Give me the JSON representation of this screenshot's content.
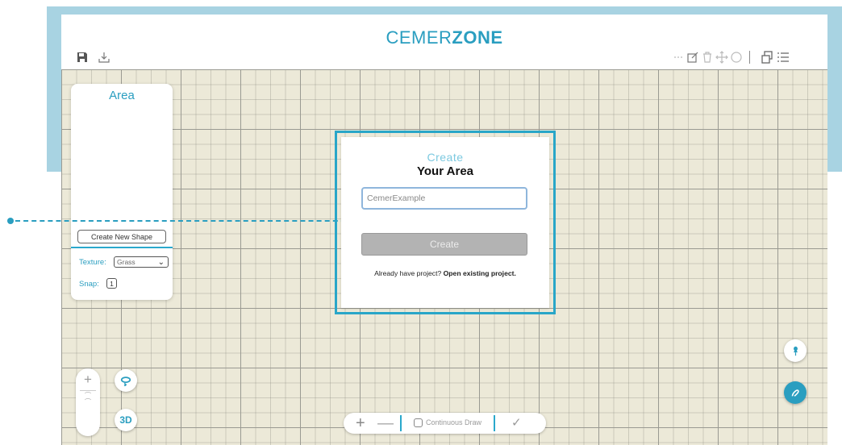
{
  "header": {
    "brand_regular": "CEMER",
    "brand_bold": "ZONE"
  },
  "toolbar": {
    "left_icons": [
      "save-icon",
      "download-icon"
    ],
    "right_icons": [
      "select-icon",
      "edit-icon",
      "trash-icon",
      "move-icon",
      "rotate-icon",
      "layers-icon",
      "list-icon"
    ]
  },
  "area_panel": {
    "title": "Area",
    "create_shape_label": "Create New Shape",
    "texture_label": "Texture:",
    "texture_value": "Grass",
    "snap_label": "Snap:",
    "snap_value": "1"
  },
  "dialog": {
    "heading_light": "Create",
    "heading_bold": "Your Area",
    "name_value": "CemerExample",
    "create_label": "Create",
    "footer_text": "Already have project? ",
    "footer_link": "Open existing project."
  },
  "view_controls": {
    "zoom_in": "+",
    "mode_3d_label": "3D"
  },
  "bottom_bar": {
    "plus": "+",
    "minus": "—",
    "continuous_label": "Continuous Draw",
    "confirm": "✓"
  },
  "colors": {
    "accent": "#2a9ec0",
    "frame": "#a8d3e2",
    "canvas": "#ece9d8"
  }
}
